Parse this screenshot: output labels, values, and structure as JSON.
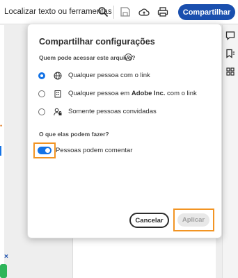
{
  "toolbar": {
    "search_text": "Localizar texto ou ferramentas",
    "share_label": "Compartilhar"
  },
  "dialog": {
    "title": "Compartilhar configurações",
    "access_question": "Quem pode acessar este arquivo?",
    "help_glyph": "?",
    "options": [
      {
        "label": "Qualquer pessoa com o link",
        "checked": true,
        "icon": "globe-icon"
      },
      {
        "label_before": "Qualquer pessoa em ",
        "label_bold": "Adobe Inc.",
        "label_after": " com o link",
        "checked": false,
        "icon": "building-icon"
      },
      {
        "label": "Somente pessoas convidadas",
        "checked": false,
        "icon": "user-lock-icon"
      }
    ],
    "permission_question": "O que elas podem fazer?",
    "toggle_label": "Pessoas podem comentar",
    "toggle_on": true,
    "cancel_label": "Cancelar",
    "apply_label": "Aplicar"
  },
  "colors": {
    "accent": "#1473e6",
    "share_button": "#1a4fae",
    "highlight": "#f29423"
  }
}
